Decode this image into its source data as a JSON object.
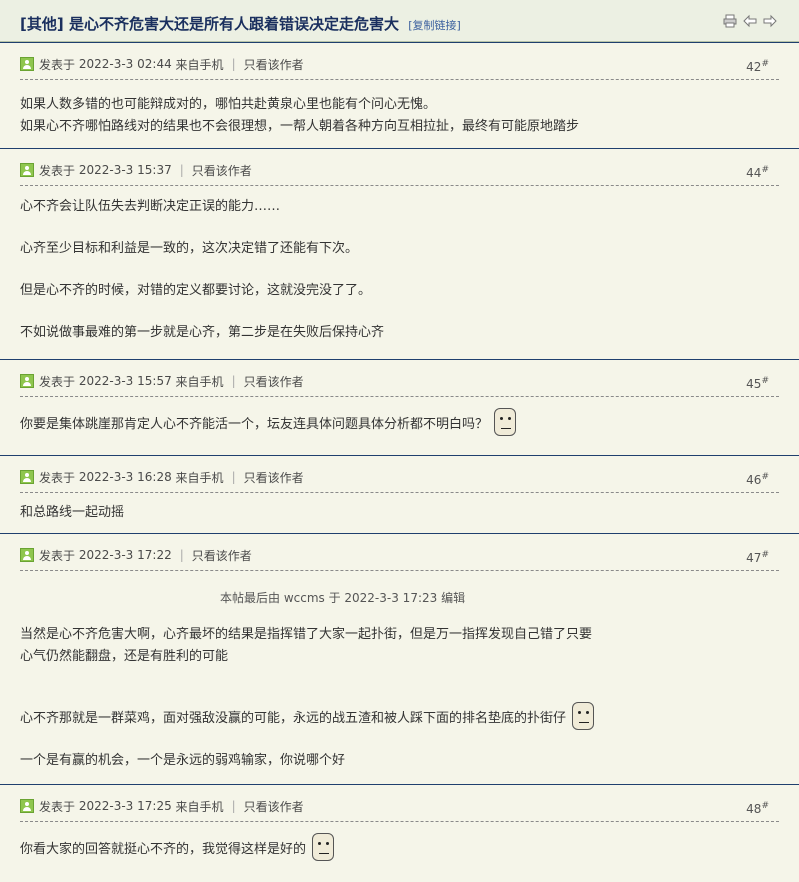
{
  "thread": {
    "category": "[其他]",
    "title": "是心不齐危害大还是所有人跟着错误决定走危害大",
    "copy_link": "[复制链接]"
  },
  "common": {
    "posted_prefix": "发表于",
    "only_author": "只看该作者",
    "floor_mark": "#"
  },
  "posts": [
    {
      "time": "2022-3-3 02:44",
      "source": "来自手机",
      "floor": "42",
      "lines": [
        "如果人数多错的也可能辩成对的，哪怕共赴黄泉心里也能有个问心无愧。",
        "如果心不齐哪怕路线对的结果也不会很理想，一帮人朝着各种方向互相拉扯，最终有可能原地踏步"
      ]
    },
    {
      "time": "2022-3-3 15:37",
      "source": "",
      "floor": "44",
      "lines": [
        "心不齐会让队伍失去判断决定正误的能力……",
        "心齐至少目标和利益是一致的，这次决定错了还能有下次。",
        "但是心不齐的时候，对错的定义都要讨论，这就没完没了了。",
        "不如说做事最难的第一步就是心齐，第二步是在失败后保持心齐"
      ]
    },
    {
      "time": "2022-3-3 15:57",
      "source": "来自手机",
      "floor": "45",
      "lines": [
        "你要是集体跳崖那肯定人心不齐能活一个，坛友连具体问题具体分析都不明白吗？"
      ]
    },
    {
      "time": "2022-3-3 16:28",
      "source": "来自手机",
      "floor": "46",
      "lines": [
        "和总路线一起动摇"
      ]
    },
    {
      "time": "2022-3-3 17:22",
      "source": "",
      "floor": "47",
      "edit_note": "本帖最后由 wccms 于 2022-3-3 17:23 编辑",
      "lines": [
        "当然是心不齐危害大啊，心齐最坏的结果是指挥错了大家一起扑街，但是万一指挥发现自己错了只要",
        "心气仍然能翻盘，还是有胜利的可能",
        "心不齐那就是一群菜鸡，面对强敌没赢的可能，永远的战五渣和被人踩下面的排名垫底的扑街仔",
        "一个是有赢的机会，一个是永远的弱鸡输家，你说哪个好"
      ]
    },
    {
      "time": "2022-3-3 17:25",
      "source": "来自手机",
      "floor": "48",
      "lines": [
        "你看大家的回答就挺心不齐的，我觉得这样是好的"
      ]
    }
  ]
}
